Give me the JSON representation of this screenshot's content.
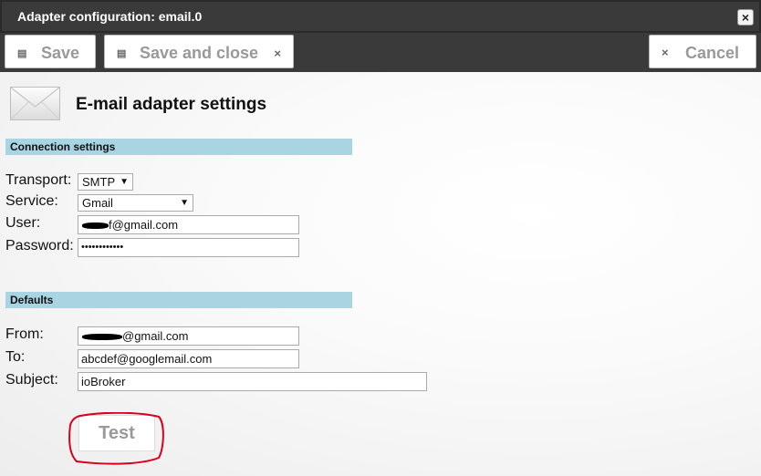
{
  "window": {
    "title": "Adapter configuration: email.0"
  },
  "toolbar": {
    "save_label": "Save",
    "save_close_label": "Save and close",
    "cancel_label": "Cancel"
  },
  "icons": {
    "save": "floppy-disk-icon",
    "close": "close-icon",
    "mail": "envelope-icon"
  },
  "page": {
    "heading": "E-mail adapter settings"
  },
  "connection": {
    "section_title": "Connection settings",
    "transport_label": "Transport:",
    "transport_value": "SMTP",
    "service_label": "Service:",
    "service_value": "Gmail",
    "user_label": "User:",
    "user_value_suffix": "f@gmail.com",
    "password_label": "Password:",
    "password_value": "••••••••••••"
  },
  "defaults": {
    "section_title": "Defaults",
    "from_label": "From:",
    "from_value_suffix": "@gmail.com",
    "to_label": "To:",
    "to_value": "abcdef@googlemail.com",
    "subject_label": "Subject:",
    "subject_value": "ioBroker"
  },
  "actions": {
    "test_label": "Test"
  },
  "colors": {
    "titlebar": "#3a3a3a",
    "section_bar": "#a9d5e2",
    "annotation_circle": "#d9001b"
  }
}
